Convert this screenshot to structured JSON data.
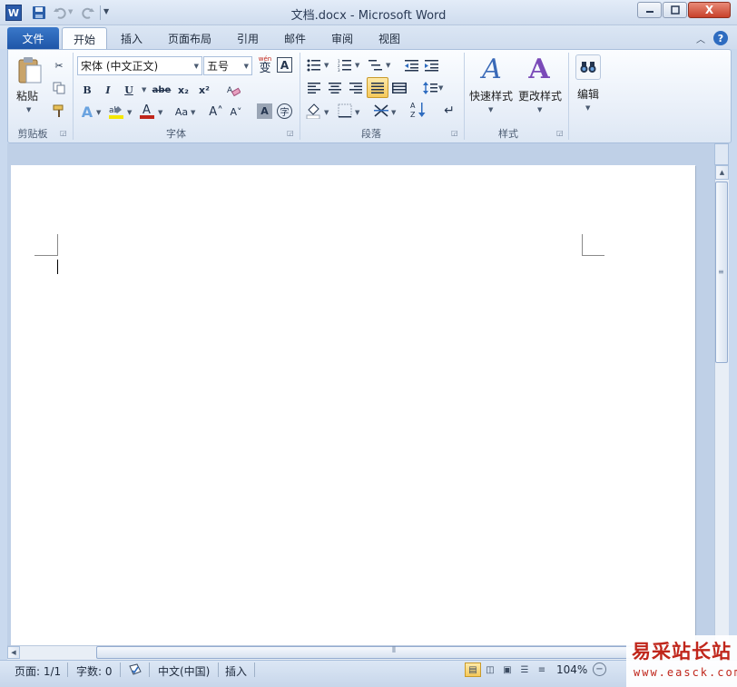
{
  "window": {
    "title": "文档.docx - Microsoft Word",
    "app_icon_letter": "W",
    "close_glyph": "X"
  },
  "tabs": {
    "file": "文件",
    "items": [
      "开始",
      "插入",
      "页面布局",
      "引用",
      "邮件",
      "审阅",
      "视图"
    ]
  },
  "ribbon": {
    "clipboard": {
      "label": "剪贴板",
      "paste": "粘贴"
    },
    "font": {
      "label": "字体",
      "font_name": "宋体 (中文正文)",
      "font_size": "五号",
      "phonetic_glyph": "wén",
      "phonetic_char": "变",
      "border_char": "A",
      "bold": "B",
      "italic": "I",
      "underline": "U",
      "strike": "abe",
      "subscript": "x₂",
      "superscript": "x²",
      "case": "Aa",
      "grow": "A˄",
      "shrink": "A˅",
      "shade_char": "A",
      "enclose_char": "字"
    },
    "paragraph": {
      "label": "段落"
    },
    "styles": {
      "label": "样式",
      "quick": "快速样式",
      "change": "更改样式"
    },
    "editing": {
      "label": "编辑"
    }
  },
  "statusbar": {
    "page": "页面: 1/1",
    "words": "字数: 0",
    "language": "中文(中国)",
    "mode": "插入",
    "zoom": "104%"
  },
  "watermark": {
    "title": "易采站长站",
    "url": "www.easck.com"
  }
}
